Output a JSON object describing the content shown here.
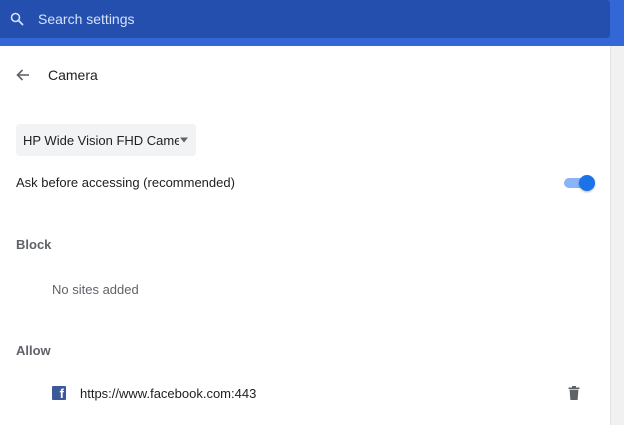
{
  "search": {
    "placeholder": "Search settings"
  },
  "header": {
    "title": "Camera"
  },
  "camera_select": {
    "selected": "HP Wide Vision FHD Camera"
  },
  "ask_setting": {
    "label": "Ask before accessing (recommended)",
    "enabled": true
  },
  "block": {
    "label": "Block",
    "empty_text": "No sites added"
  },
  "allow": {
    "label": "Allow",
    "sites": [
      {
        "url": "https://www.facebook.com:443",
        "icon": "facebook-icon"
      }
    ]
  },
  "colors": {
    "topbar": "#3367d6",
    "search_box": "#254fae",
    "toggle_on": "#1a73e8",
    "facebook": "#3b5998"
  }
}
